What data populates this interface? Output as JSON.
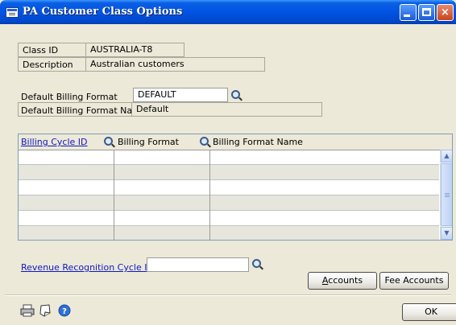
{
  "window": {
    "title": "PA Customer Class Options",
    "controls": {
      "minimize_glyph": "_",
      "maximize_glyph": "□",
      "close_glyph": "×"
    }
  },
  "header": {
    "class_id": {
      "label": "Class ID",
      "value": "AUSTRALIA-T8"
    },
    "description": {
      "label": "Description",
      "value": "Australian customers"
    }
  },
  "billing": {
    "format": {
      "label": "Default Billing Format",
      "value": "DEFAULT"
    },
    "format_name": {
      "label": "Default Billing Format Name",
      "value": "Default"
    }
  },
  "grid": {
    "columns": [
      {
        "label": "Billing Cycle ID",
        "link": true
      },
      {
        "label": "Billing Format",
        "link": false
      },
      {
        "label": "Billing Format Name",
        "link": false
      }
    ],
    "rows": [
      [
        "",
        "",
        ""
      ],
      [
        "",
        "",
        ""
      ],
      [
        "",
        "",
        ""
      ],
      [
        "",
        "",
        ""
      ],
      [
        "",
        "",
        ""
      ],
      [
        "",
        "",
        ""
      ]
    ],
    "scroll_up_glyph": "▲",
    "scroll_down_glyph": "▼"
  },
  "revenue": {
    "label": "Revenue Recognition Cycle ID",
    "value": ""
  },
  "buttons": {
    "accounts": {
      "underline": "A",
      "rest": "ccounts"
    },
    "fee_accounts": {
      "label": "Fee Accounts"
    },
    "ok": {
      "label": "OK"
    }
  },
  "footer": {
    "icons": [
      "print-icon",
      "note-icon",
      "help-icon"
    ],
    "help_glyph": "?"
  }
}
